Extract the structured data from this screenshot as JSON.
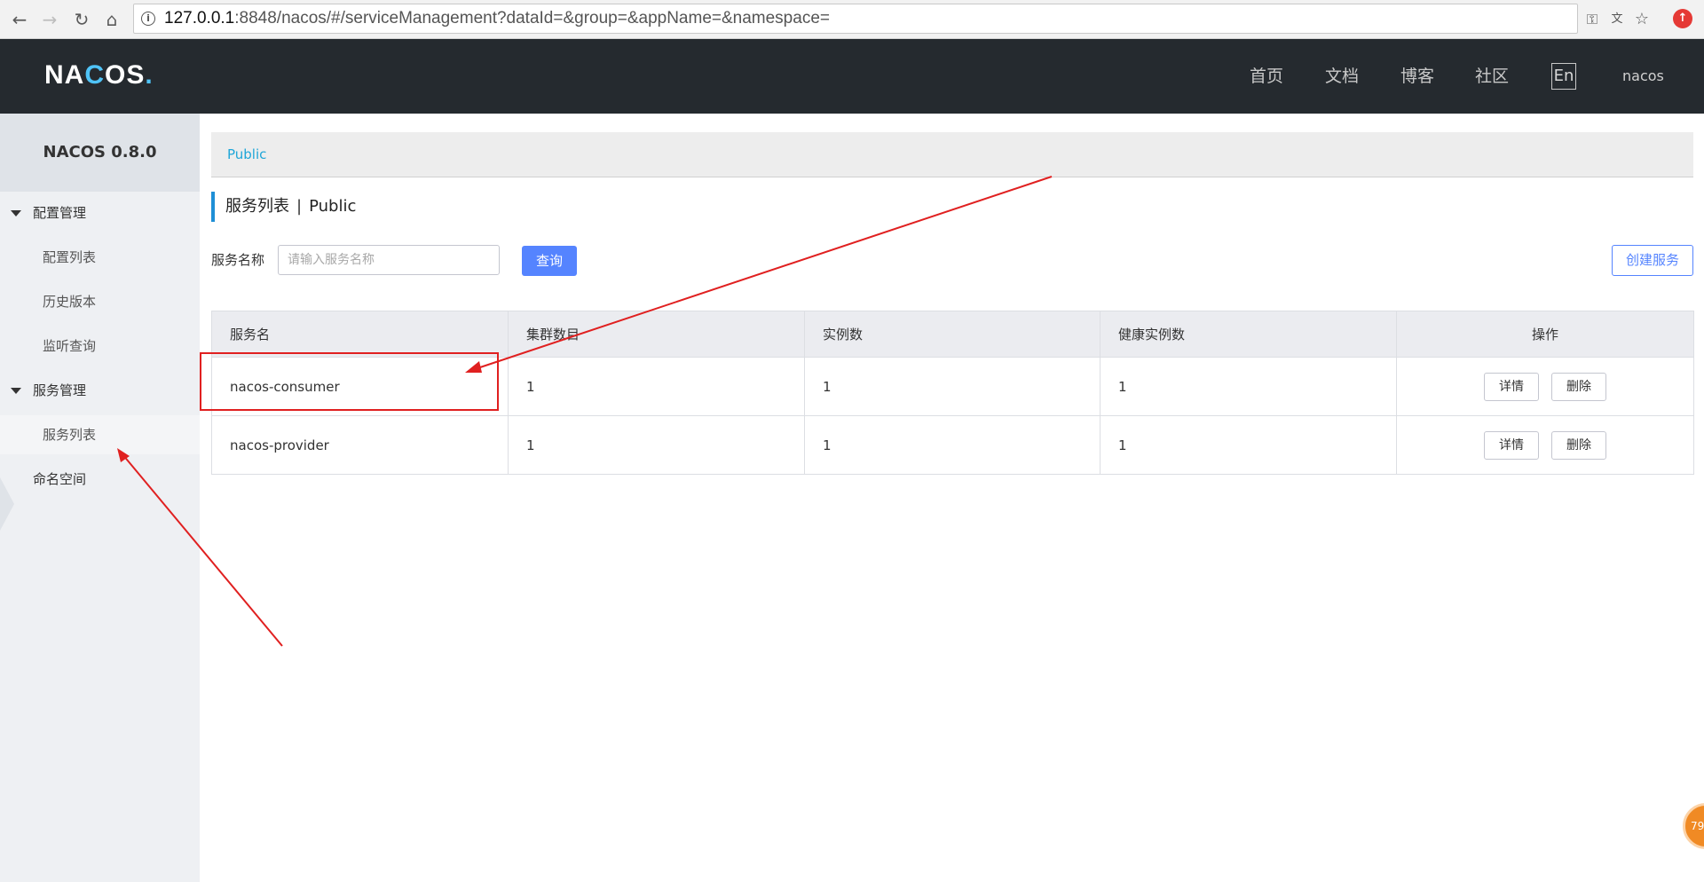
{
  "browser": {
    "url_host": "127.0.0.1",
    "url_rest": ":8848/nacos/#/serviceManagement?dataId=&group=&appName=&namespace="
  },
  "header": {
    "logo_prefix": "NA",
    "logo_o": "C",
    "logo_mid": "OS",
    "logo_dot": ".",
    "nav": [
      "首页",
      "文档",
      "博客",
      "社区"
    ],
    "lang": "En",
    "user": "nacos"
  },
  "sidebar": {
    "title": "NACOS 0.8.0",
    "config_group": "配置管理",
    "config_items": [
      "配置列表",
      "历史版本",
      "监听查询"
    ],
    "service_group": "服务管理",
    "service_items": [
      "服务列表"
    ],
    "namespace": "命名空间"
  },
  "main": {
    "namespace_tab": "Public",
    "title": "服务列表",
    "title_sep": "|",
    "title_ns": "Public",
    "search_label": "服务名称",
    "search_placeholder": "请输入服务名称",
    "search_value": "",
    "query_button": "查询",
    "create_button": "创建服务"
  },
  "table": {
    "columns": [
      "服务名",
      "集群数目",
      "实例数",
      "健康实例数",
      "操作"
    ],
    "rows": [
      {
        "name": "nacos-consumer",
        "clusters": "1",
        "instances": "1",
        "healthy": "1"
      },
      {
        "name": "nacos-provider",
        "clusters": "1",
        "instances": "1",
        "healthy": "1"
      }
    ],
    "detail_button": "详情",
    "delete_button": "删除"
  },
  "floating_badge": "79",
  "colors": {
    "header_bg": "#252a2f",
    "primary": "#5584ff",
    "annotation_red": "#e02020"
  }
}
